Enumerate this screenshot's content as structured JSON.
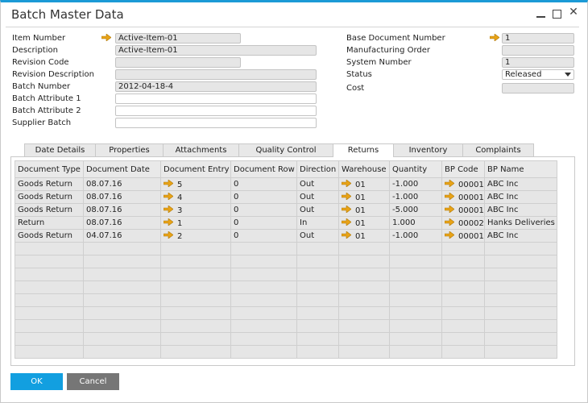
{
  "window": {
    "title": "Batch Master Data",
    "controls": {
      "minimize": "minimize",
      "maximize": "maximize",
      "close": "close"
    }
  },
  "header_left": {
    "item_number": {
      "label": "Item Number",
      "value": "Active-Item-01",
      "has_link_arrow": true
    },
    "description": {
      "label": "Description",
      "value": "Active-Item-01"
    },
    "revision_code": {
      "label": "Revision Code",
      "value": ""
    },
    "revision_description": {
      "label": "Revision Description",
      "value": ""
    },
    "batch_number": {
      "label": "Batch Number",
      "value": "2012-04-18-4"
    },
    "batch_attribute_1": {
      "label": "Batch Attribute 1",
      "value": ""
    },
    "batch_attribute_2": {
      "label": "Batch Attribute 2",
      "value": ""
    },
    "supplier_batch": {
      "label": "Supplier Batch",
      "value": ""
    }
  },
  "header_right": {
    "base_document_number": {
      "label": "Base Document Number",
      "value": "1",
      "has_link_arrow": true
    },
    "manufacturing_order": {
      "label": "Manufacturing Order",
      "value": ""
    },
    "system_number": {
      "label": "System Number",
      "value": "1"
    },
    "status": {
      "label": "Status",
      "value": "Released"
    },
    "cost": {
      "label": "Cost",
      "value": ""
    }
  },
  "tabs": [
    {
      "label": "Date Details",
      "active": false
    },
    {
      "label": "Properties",
      "active": false
    },
    {
      "label": "Attachments",
      "active": false
    },
    {
      "label": "Quality Control",
      "active": false
    },
    {
      "label": "Returns",
      "active": true
    },
    {
      "label": "Inventory",
      "active": false
    },
    {
      "label": "Complaints",
      "active": false
    }
  ],
  "returns_table": {
    "columns": [
      "Document Type",
      "Document Date",
      "Document Entry",
      "Document Row",
      "Direction",
      "Warehouse",
      "Quantity",
      "BP Code",
      "BP Name"
    ],
    "rows": [
      [
        "Goods Return",
        "08.07.16",
        "5",
        "0",
        "Out",
        "01",
        "-1.000",
        "00001",
        "ABC Inc"
      ],
      [
        "Goods Return",
        "08.07.16",
        "4",
        "0",
        "Out",
        "01",
        "-1.000",
        "00001",
        "ABC Inc"
      ],
      [
        "Goods Return",
        "08.07.16",
        "3",
        "0",
        "Out",
        "01",
        "-5.000",
        "00001",
        "ABC Inc"
      ],
      [
        "Return",
        "08.07.16",
        "1",
        "0",
        "In",
        "01",
        "1.000",
        "00002",
        "Hanks Deliveries"
      ],
      [
        "Goods Return",
        "04.07.16",
        "2",
        "0",
        "Out",
        "01",
        "-1.000",
        "00001",
        "ABC Inc"
      ]
    ],
    "link_arrow_columns": [
      2,
      5,
      7
    ],
    "empty_rows": 9
  },
  "buttons": {
    "ok": "OK",
    "cancel": "Cancel"
  },
  "colors": {
    "accent": "#1b9ad6",
    "ok_button": "#129fe0",
    "cancel_button": "#767676",
    "link_arrow": "#e8a317"
  }
}
